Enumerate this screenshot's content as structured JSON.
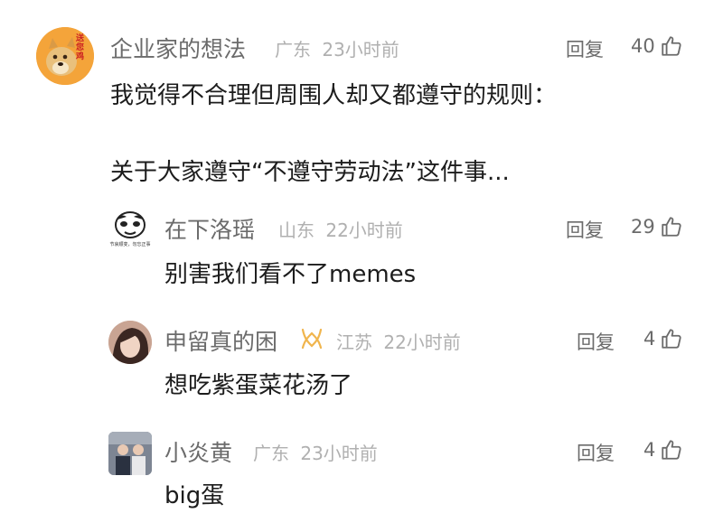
{
  "comment": {
    "author": "企业家的想法",
    "location": "广东",
    "time": "23小时前",
    "reply_label": "回复",
    "likes": "40",
    "line1": "我觉得不合理但周围人却又都遵守的规则：",
    "line2": "关于大家遵守“不遵守劳动法”这件事...",
    "avatar_text": "送您鸡"
  },
  "replies": [
    {
      "author": "在下洛瑶",
      "location": "山东",
      "time": "22小时前",
      "reply_label": "回复",
      "likes": "29",
      "text": "别害我们看不了memes",
      "avatar_caption": "节哀顺变，勿忘正事"
    },
    {
      "author": "申留真的困",
      "location": "江苏",
      "time": "22小时前",
      "reply_label": "回复",
      "likes": "4",
      "text": "想吃紫蛋菜花汤了"
    },
    {
      "author": "小炎黄",
      "location": "广东",
      "time": "23小时前",
      "reply_label": "回复",
      "likes": "4",
      "text": "big蛋"
    }
  ],
  "colors": {
    "badge": "#f0b54d",
    "text": "#1c1c1c",
    "muted": "#6b6b6b",
    "meta": "#b0b0b0"
  }
}
